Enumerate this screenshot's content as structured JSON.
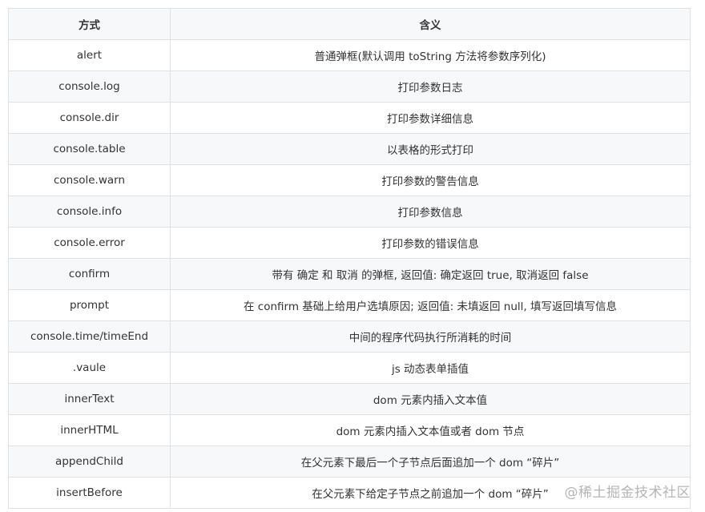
{
  "table": {
    "headers": [
      "方式",
      "含义"
    ],
    "rows": [
      [
        "alert",
        "普通弹框(默认调用 toString 方法将参数序列化)"
      ],
      [
        "console.log",
        "打印参数日志"
      ],
      [
        "console.dir",
        "打印参数详细信息"
      ],
      [
        "console.table",
        "以表格的形式打印"
      ],
      [
        "console.warn",
        "打印参数的警告信息"
      ],
      [
        "console.info",
        "打印参数信息"
      ],
      [
        "console.error",
        "打印参数的错误信息"
      ],
      [
        "confirm",
        "带有 确定 和 取消 的弹框, 返回值: 确定返回 true, 取消返回 false"
      ],
      [
        "prompt",
        "在 confirm 基础上给用户选填原因; 返回值: 未填返回 null, 填写返回填写信息"
      ],
      [
        "console.time/timeEnd",
        "中间的程序代码执行所消耗的时间"
      ],
      [
        ".vaule",
        "js 动态表单插值"
      ],
      [
        "innerText",
        "dom 元素内插入文本值"
      ],
      [
        "innerHTML",
        "dom 元素内插入文本值或者 dom 节点"
      ],
      [
        "appendChild",
        "在父元素下最后一个子节点后面追加一个 dom “碎片”"
      ],
      [
        "insertBefore",
        "在父元素下给定子节点之前追加一个 dom “碎片”"
      ]
    ]
  },
  "watermark": "@稀土掘金技术社区"
}
